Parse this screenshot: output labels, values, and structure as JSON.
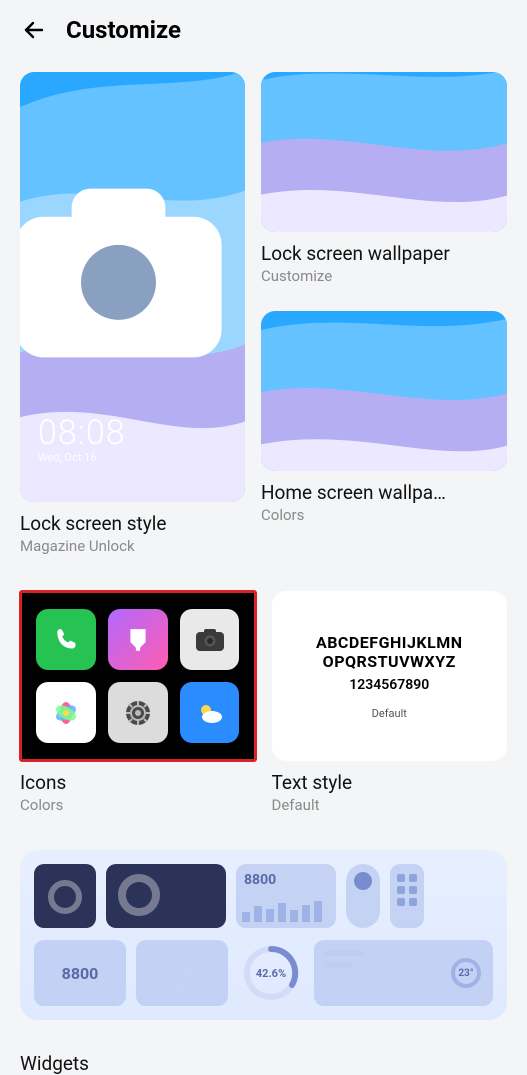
{
  "header": {
    "title": "Customize"
  },
  "lock_style": {
    "title": "Lock screen style",
    "subtitle": "Magazine Unlock",
    "time": "08:08",
    "date": "Wed, Oct 16"
  },
  "lock_wallpaper": {
    "title": "Lock screen wallpaper",
    "subtitle": "Customize"
  },
  "home_wallpaper": {
    "title": "Home screen wallpa…",
    "subtitle": "Colors"
  },
  "icons": {
    "title": "Icons",
    "subtitle": "Colors"
  },
  "text_style": {
    "title": "Text style",
    "subtitle": "Default",
    "line1": "ABCDEFGHIJKLMN",
    "line2": "OPQRSTUVWXYZ",
    "line3": "1234567890",
    "line4": "Default"
  },
  "widgets": {
    "title": "Widgets",
    "num": "8800",
    "pct": "42.6%",
    "temp": "23°"
  }
}
